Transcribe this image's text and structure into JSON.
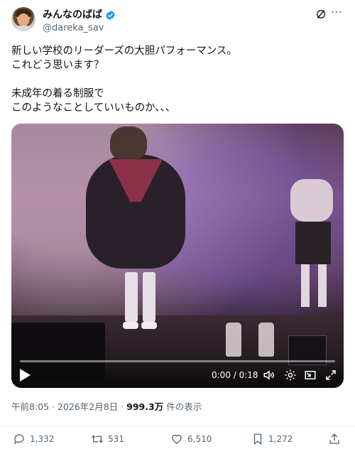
{
  "author": {
    "display_name": "みんなのばば",
    "handle": "@dareka_sav",
    "verified": true
  },
  "header_icons": [
    "grok-icon",
    "more-icon"
  ],
  "tweet": {
    "text": "新しい学校のリーダーズの大胆パフォーマンス。\nこれどう思います？\n\n未成年の着る制服で\nこのようなことしていいものか、、、"
  },
  "video": {
    "time": "0:00 / 0:18",
    "controls": [
      "play-icon",
      "volume-icon",
      "settings-icon",
      "pip-icon",
      "fullscreen-icon"
    ]
  },
  "meta": {
    "timestamp": "午前8:05 · 2026年2月8日 · ",
    "views_count": "999.3万",
    "views_label": "件の表示"
  },
  "actions": {
    "replies": "1,332",
    "reposts": "531",
    "likes": "6,510",
    "bookmarks": "1,272"
  },
  "colors": {
    "verified": "#1d9bf0",
    "secondary_text": "#536471",
    "primary_text": "#0f1419"
  }
}
